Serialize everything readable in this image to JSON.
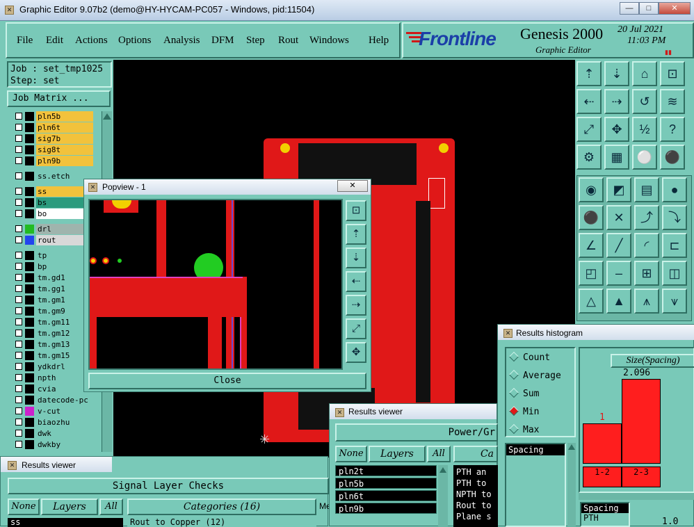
{
  "window": {
    "title": "Graphic Editor 9.07b2 (demo@HY-HYCAM-PC057 - Windows, pid:11504)",
    "min": "—",
    "max": "□",
    "close": "✕"
  },
  "menu": [
    "File",
    "Edit",
    "Actions",
    "Options",
    "Analysis",
    "DFM",
    "Step",
    "Rout",
    "Windows",
    "Help"
  ],
  "brand": {
    "logo": "Frontline",
    "product": "Genesis 2000",
    "subtitle": "Graphic Editor",
    "date": "20 Jul 2021",
    "time": "11:03 PM",
    "indicator": "▮▮"
  },
  "job": {
    "job_line": "Job : set_tmp1025",
    "step_line": "Step: set",
    "matrix_button": "Job Matrix ..."
  },
  "layers": [
    {
      "name": "pln5b",
      "bg": "#f2c23c"
    },
    {
      "name": "pln6t",
      "bg": "#f2c23c"
    },
    {
      "name": "sig7b",
      "bg": "#f2c23c"
    },
    {
      "name": "sig8t",
      "bg": "#f2c23c"
    },
    {
      "name": "pln9b",
      "bg": "#f2c23c"
    },
    {
      "name": "ss.etch",
      "bg": "#79c9b8"
    },
    {
      "name": "ss",
      "bg": "#f2c23c"
    },
    {
      "name": "bs",
      "bg": "#2c9b7e"
    },
    {
      "name": "bo",
      "bg": "#ffffff"
    },
    {
      "name": "drl",
      "bg": "#9fb4ad",
      "sw": "#22bb22"
    },
    {
      "name": "rout",
      "bg": "#d8d8d8",
      "sw": "#2244ee"
    },
    {
      "name": "tp",
      "bg": "#79c9b8"
    },
    {
      "name": "bp",
      "bg": "#79c9b8"
    },
    {
      "name": "tm.gd1",
      "bg": "#79c9b8"
    },
    {
      "name": "tm.gg1",
      "bg": "#79c9b8"
    },
    {
      "name": "tm.gm1",
      "bg": "#79c9b8"
    },
    {
      "name": "tm.gm9",
      "bg": "#79c9b8"
    },
    {
      "name": "tm.gm11",
      "bg": "#79c9b8"
    },
    {
      "name": "tm.gm12",
      "bg": "#79c9b8"
    },
    {
      "name": "tm.gm13",
      "bg": "#79c9b8"
    },
    {
      "name": "tm.gm15",
      "bg": "#79c9b8"
    },
    {
      "name": "ydkdrl",
      "bg": "#79c9b8"
    },
    {
      "name": "npth",
      "bg": "#79c9b8"
    },
    {
      "name": "cvia",
      "bg": "#79c9b8"
    },
    {
      "name": "datecode-pc",
      "bg": "#79c9b8"
    },
    {
      "name": "v-cut",
      "bg": "#79c9b8",
      "sw": "#cc22cc"
    },
    {
      "name": "biaozhu",
      "bg": "#79c9b8"
    },
    {
      "name": "dwk",
      "bg": "#79c9b8"
    },
    {
      "name": "dwkby",
      "bg": "#79c9b8"
    }
  ],
  "popview": {
    "title": "Popview - 1",
    "close": "Close",
    "x": "✕"
  },
  "histogram": {
    "title": "Results histogram",
    "options": [
      "Count",
      "Average",
      "Sum",
      "Min",
      "Max"
    ],
    "selected": "Min",
    "list_item": "Spacing",
    "chart_title": "Size(Spacing)",
    "bar1_value": "1",
    "bar2_value": "2.096",
    "bin1": "1-2",
    "bin2": "2-3",
    "list2": [
      "Spacing",
      "PTH"
    ],
    "value": "1.0"
  },
  "results_viewer_left": {
    "title": "Results viewer",
    "header": "Signal Layer Checks",
    "btn_none": "None",
    "btn_layers": "Layers",
    "btn_all": "All",
    "categories": "Categories (16)",
    "extra": "Me",
    "row1": "ss",
    "row2": "Rout to Copper (12)"
  },
  "results_viewer_mid": {
    "title": "Results viewer",
    "header": "Power/Gr",
    "btn_none": "None",
    "btn_layers": "Layers",
    "btn_all": "All",
    "cat": "Ca",
    "layers": [
      "pln2t",
      "pln5b",
      "pln6t",
      "pln9b"
    ],
    "cats": [
      "PTH an",
      "PTH to",
      "NPTH to",
      "Rout to",
      "Plane s"
    ]
  }
}
